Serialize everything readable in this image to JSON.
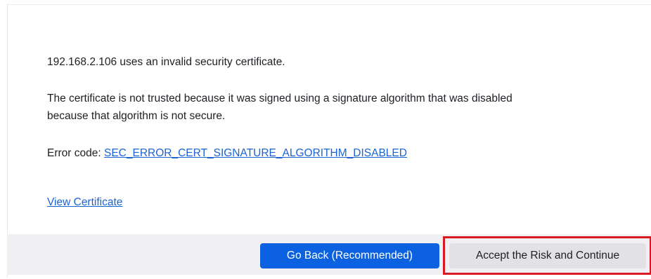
{
  "error_page": {
    "host_message": "192.168.2.106 uses an invalid security certificate.",
    "explanation_line1": "The certificate is not trusted because it was signed using a signature algorithm that was disabled",
    "explanation_line2": "because that algorithm is not secure.",
    "error_code_label": "Error code: ",
    "error_code_value": "SEC_ERROR_CERT_SIGNATURE_ALGORITHM_DISABLED",
    "view_certificate_label": "View Certificate"
  },
  "footer": {
    "go_back_label": "Go Back (Recommended)",
    "accept_risk_label": "Accept the Risk and Continue"
  },
  "colors": {
    "primary_button": "#0b61e0",
    "link": "#1a62d6",
    "highlight_border": "#d81b22"
  }
}
